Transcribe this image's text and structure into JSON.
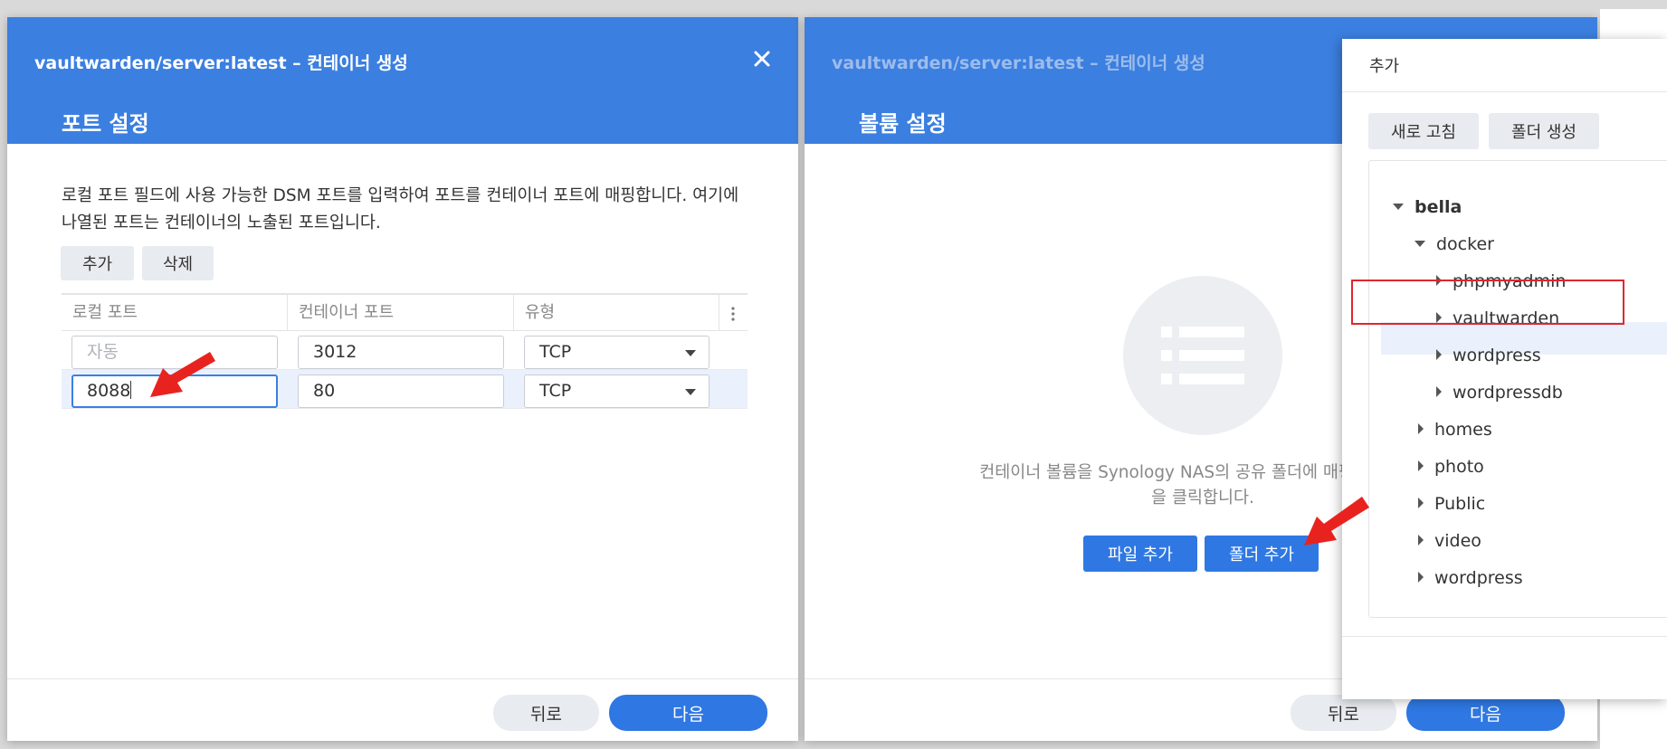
{
  "left_dialog": {
    "window_title": "vaultwarden/server:latest – 컨테이너 생성",
    "step_title": "포트 설정",
    "description": "로컬 포트 필드에 사용 가능한 DSM 포트를 입력하여 포트를 컨테이너 포트에 매핑합니다. 여기에 나열된 포트는 컨테이너의 노출된 포트입니다.",
    "add_button": "추가",
    "delete_button": "삭제",
    "columns": [
      "로컬 포트",
      "컨테이너 포트",
      "유형"
    ],
    "rows": [
      {
        "local_port": "",
        "local_placeholder": "자동",
        "container_port": "3012",
        "type": "TCP"
      },
      {
        "local_port": "8088",
        "local_placeholder": "",
        "container_port": "80",
        "type": "TCP"
      }
    ],
    "back_button": "뒤로",
    "next_button": "다음"
  },
  "middle_dialog": {
    "window_title": "vaultwarden/server:latest – 컨테이너 생성",
    "step_title": "볼륨 설정",
    "empty_text_line1": "컨테이너 볼륨을 Synology NAS의 공유 폴더에 매핑합니다. 여",
    "empty_text_line2": "을 클릭합니다.",
    "add_file_button": "파일 추가",
    "add_folder_button": "폴더 추가",
    "back_button": "뒤로",
    "next_button": "다음"
  },
  "folder_popup": {
    "title": "추가",
    "refresh_button": "새로 고침",
    "create_folder_button": "폴더 생성",
    "tree": {
      "root": "bella",
      "docker": "docker",
      "docker_children": [
        "phpmyadmin",
        "vaultwarden",
        "wordpress",
        "wordpressdb"
      ],
      "others": [
        "homes",
        "photo",
        "Public",
        "video",
        "wordpress"
      ]
    },
    "selected": "vaultwarden"
  },
  "colors": {
    "header_blue": "#3b7fe0",
    "button_blue": "#2f78e3",
    "highlight_red": "#e0262c",
    "arrow_red": "#e8231f"
  }
}
